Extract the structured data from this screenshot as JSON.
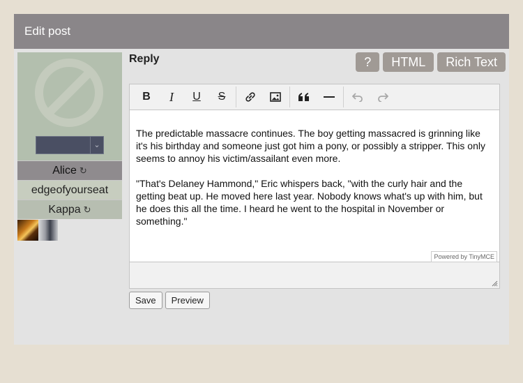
{
  "header": {
    "title": "Edit post"
  },
  "sidebar": {
    "character_select_value": "",
    "rows": [
      {
        "label": "Alice",
        "refresh": true
      },
      {
        "label": "edgeofyourseat",
        "refresh": false
      },
      {
        "label": "Kappa",
        "refresh": true
      }
    ]
  },
  "main": {
    "reply_label": "Reply",
    "mode_buttons": {
      "help": "?",
      "html": "HTML",
      "rich_text": "Rich Text"
    },
    "editor": {
      "paragraphs": [
        "The predictable massacre continues. The boy getting massacred is grinning like it's his birthday and someone just got him a pony, or possibly a stripper. This only seems to annoy his victim/assailant even more.",
        "\"That's Delaney Hammond,\" Eric whispers back, \"with the curly hair and the getting beat up. He moved here last year. Nobody knows what's up with him, but he does this all the time. I heard he went to the hospital in November or something.\""
      ],
      "powered_by": "Powered by TinyMCE"
    },
    "actions": {
      "save": "Save",
      "preview": "Preview"
    }
  },
  "icons": {
    "bold": "B",
    "italic": "I",
    "underline": "U",
    "strike": "S",
    "refresh": "↻"
  }
}
